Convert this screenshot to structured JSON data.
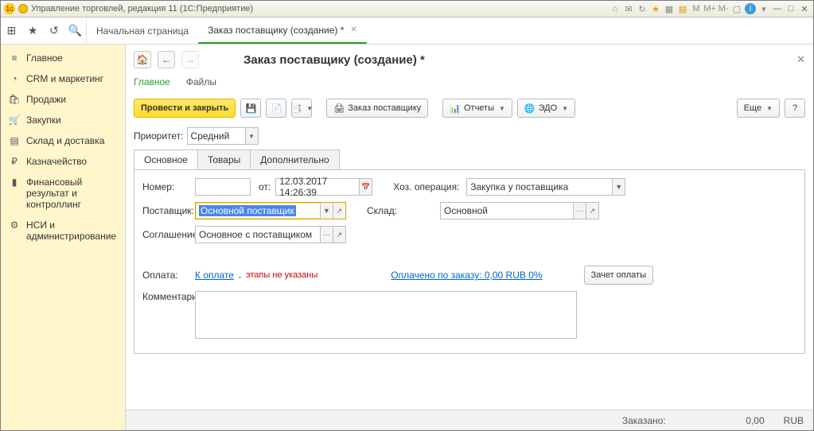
{
  "title": "Управление торговлей, редакция 11  (1С:Предприятие)",
  "window_icons": {
    "m1": "M",
    "m2": "M+",
    "m3": "M-"
  },
  "tabbar": {
    "start": "Начальная страница",
    "order": "Заказ поставщику (создание) *"
  },
  "sidebar": {
    "items": [
      {
        "icon": "home",
        "label": "Главное"
      },
      {
        "icon": "crm",
        "label": "CRM и маркетинг"
      },
      {
        "icon": "sales",
        "label": "Продажи"
      },
      {
        "icon": "cart",
        "label": "Закупки"
      },
      {
        "icon": "stock",
        "label": "Склад и доставка"
      },
      {
        "icon": "money",
        "label": "Казначейство"
      },
      {
        "icon": "chart",
        "label": "Финансовый результат и контроллинг"
      },
      {
        "icon": "gear",
        "label": "НСИ и администрирование"
      }
    ]
  },
  "page": {
    "title": "Заказ поставщику (создание) *",
    "subtabs": {
      "main": "Главное",
      "files": "Файлы"
    },
    "toolbar": {
      "post_close": "Провести и закрыть",
      "order_supplier": "Заказ поставщику",
      "reports": "Отчеты",
      "edo": "ЭДО",
      "more": "Еще",
      "help": "?"
    },
    "priority": {
      "label": "Приоритет:",
      "value": "Средний"
    },
    "tabs": {
      "main": "Основное",
      "goods": "Товары",
      "extra": "Дополнительно"
    },
    "fields": {
      "number_label": "Номер:",
      "number": "",
      "from_label": "от:",
      "date": "12.03.2017 14:26:39",
      "operation_label": "Хоз. операция:",
      "operation": "Закупка у поставщика",
      "supplier_label": "Поставщик:",
      "supplier": "Основной поставщик",
      "warehouse_label": "Склад:",
      "warehouse": "Основной",
      "agreement_label": "Соглашение:",
      "agreement": "Основное с поставщиком",
      "payment_label": "Оплата:",
      "to_pay": "К оплате",
      "stages": "этапы не указаны",
      "paid": "Оплачено по заказу: 0,00 RUB  0%",
      "offset": "Зачет оплаты",
      "comment_label": "Комментарий:"
    },
    "status": {
      "ordered_label": "Заказано:",
      "ordered_value": "0,00",
      "currency": "RUB"
    }
  }
}
